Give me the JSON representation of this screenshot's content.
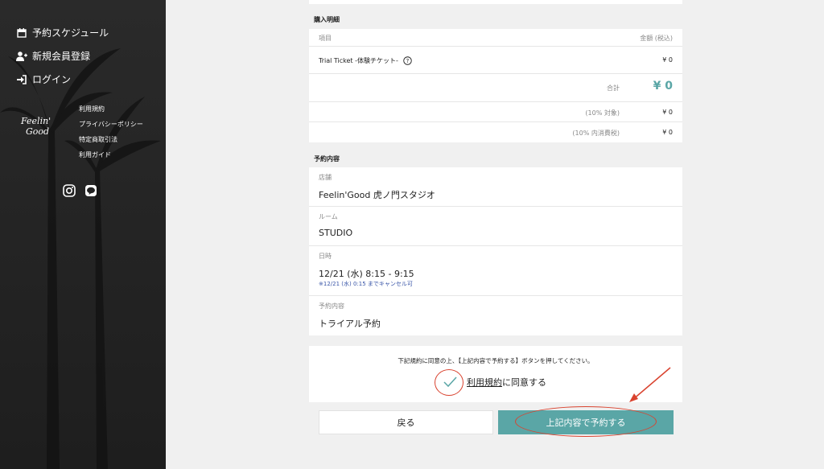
{
  "sidebar": {
    "nav": [
      {
        "label": "予約スケジュール",
        "icon": "calendar-icon"
      },
      {
        "label": "新規会員登録",
        "icon": "user-plus-icon"
      },
      {
        "label": "ログイン",
        "icon": "sign-in-icon"
      }
    ],
    "logo_line1": "Feelin'",
    "logo_line2": "Good",
    "links": [
      "利用規約",
      "プライバシーポリシー",
      "特定商取引法",
      "利用ガイド"
    ],
    "social": [
      "instagram-icon",
      "line-icon"
    ]
  },
  "purchase": {
    "title": "購入明細",
    "header_item": "項目",
    "header_amount": "金額 (税込)",
    "item_name": "Trial Ticket -体験チケット-",
    "item_price": "¥ 0",
    "total_label": "合計",
    "total_value": "¥ 0",
    "tax1_label": "(10% 対象)",
    "tax1_value": "¥ 0",
    "tax2_label": "(10% 内消費税)",
    "tax2_value": "¥ 0"
  },
  "reservation": {
    "title": "予約内容",
    "store_label": "店舗",
    "store_value": "Feelin'Good 虎ノ門スタジオ",
    "room_label": "ルーム",
    "room_value": "STUDIO",
    "datetime_label": "日時",
    "datetime_value": "12/21 (水) 8:15 - 9:15",
    "cancel_note": "※12/21 (水) 0:15 までキャンセル可",
    "content_label": "予約内容",
    "content_value": "トライアル予約"
  },
  "agreement": {
    "note": "下記規約に同意の上、【上記内容で予約する】ボタンを押してください。",
    "terms_link": "利用規約",
    "agree_suffix": "に同意する",
    "checked": true
  },
  "buttons": {
    "back": "戻る",
    "confirm": "上記内容で予約する"
  },
  "colors": {
    "accent": "#5aa6a6",
    "annotation": "#d9432f",
    "sidebar_bg": "#222222",
    "note_blue": "#3a56a8"
  }
}
